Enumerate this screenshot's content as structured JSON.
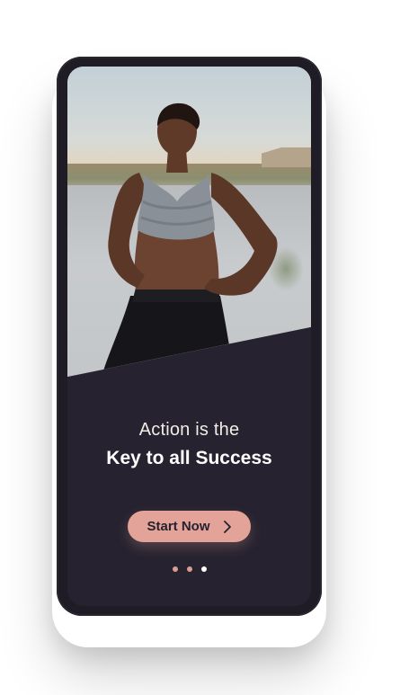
{
  "onboarding": {
    "headline_line1": "Action is the",
    "headline_line2": "Key to all Success",
    "cta_label": "Start Now",
    "page_indicator": {
      "total": 3,
      "active_index": 2
    }
  },
  "colors": {
    "screen_background": "#26222f",
    "accent": "#e3a399",
    "dot_inactive": "#d99d93",
    "dot_active": "#ffffff",
    "text_primary": "#ffffff"
  },
  "icons": {
    "cta_icon": "chevron-right-icon"
  }
}
